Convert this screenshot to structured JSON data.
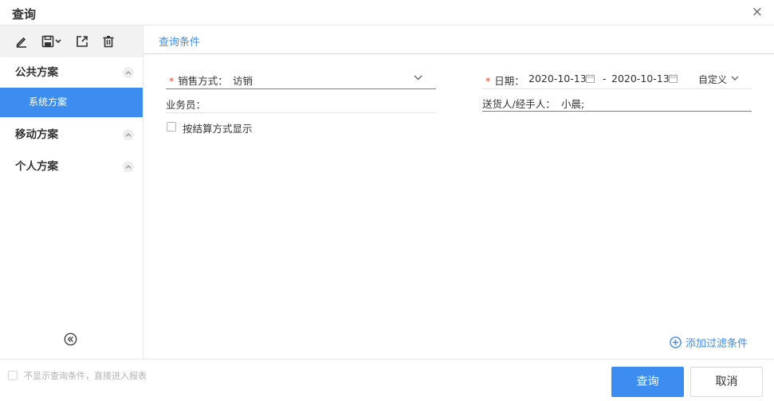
{
  "dialog": {
    "title": "查询",
    "close_glyph": "×"
  },
  "sidebar": {
    "toolbar": [
      "edit-icon",
      "save-icon",
      "export-icon",
      "trash-icon"
    ],
    "groups": [
      {
        "label": "公共方案",
        "items": [
          {
            "label": "系统方案",
            "selected": true
          }
        ]
      },
      {
        "label": "移动方案",
        "items": []
      },
      {
        "label": "个人方案",
        "items": []
      }
    ]
  },
  "main": {
    "tab": "查询条件",
    "fields": {
      "sales_method": {
        "label": "销售方式：",
        "required": true,
        "value": "访销"
      },
      "date": {
        "label": "日期：",
        "required": true,
        "start": "2020-10-13",
        "separator": "-",
        "end": "2020-10-13",
        "range": "自定义"
      },
      "salesman": {
        "label": "业务员：",
        "value": ""
      },
      "handler": {
        "label": "送货人/经手人：",
        "value": "小晨;"
      },
      "settle_display": {
        "label": "按结算方式显示",
        "checked": false
      }
    },
    "add_filter": "添加过滤条件"
  },
  "footer": {
    "skip_label": "不显示查询条件，直接进入报表",
    "query_button": "查询",
    "cancel_button": "取消"
  },
  "colors": {
    "accent": "#3d8cf0",
    "required": "#f04134",
    "toolbar_bg": "#f2f2f2"
  }
}
